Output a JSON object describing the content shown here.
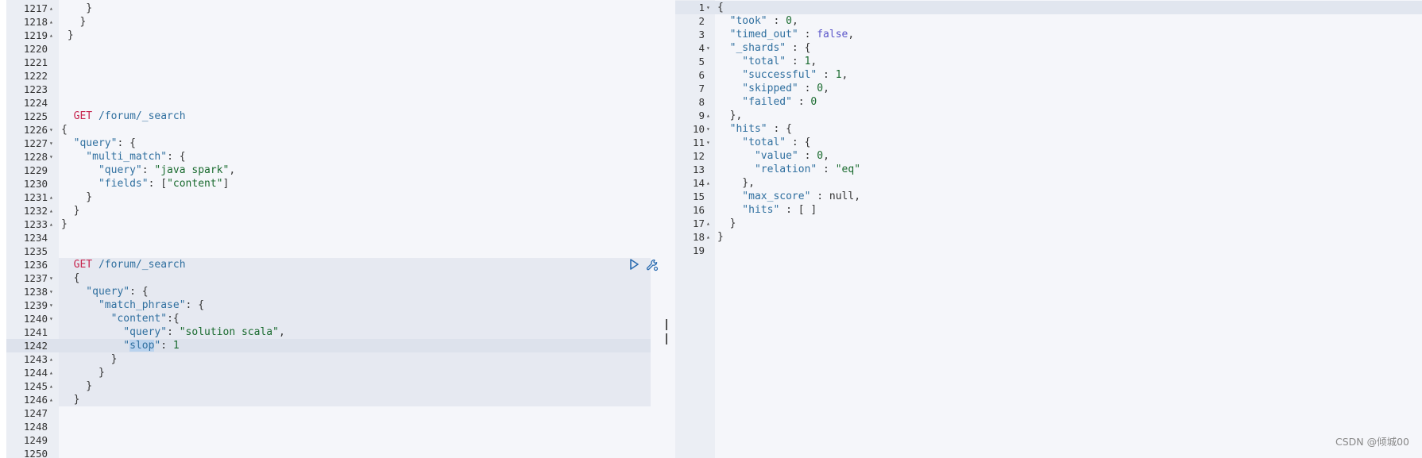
{
  "left": {
    "lines": [
      {
        "n": "1217",
        "fold": "▴",
        "code": [
          {
            "t": "    }",
            "c": "p"
          }
        ]
      },
      {
        "n": "1218",
        "fold": "▴",
        "code": [
          {
            "t": "   }",
            "c": "p"
          }
        ]
      },
      {
        "n": "1219",
        "fold": "▴",
        "code": [
          {
            "t": " }",
            "c": "p"
          }
        ]
      },
      {
        "n": "1220",
        "fold": "",
        "code": []
      },
      {
        "n": "1221",
        "fold": "",
        "code": []
      },
      {
        "n": "1222",
        "fold": "",
        "code": []
      },
      {
        "n": "1223",
        "fold": "",
        "code": []
      },
      {
        "n": "1224",
        "fold": "",
        "code": []
      },
      {
        "n": "1225",
        "fold": "",
        "code": [
          {
            "t": "  GET",
            "c": "m"
          },
          {
            "t": " /forum/_search",
            "c": "k"
          }
        ]
      },
      {
        "n": "1226",
        "fold": "▾",
        "code": [
          {
            "t": "{",
            "c": "p"
          }
        ]
      },
      {
        "n": "1227",
        "fold": "▾",
        "code": [
          {
            "t": "  \"query\"",
            "c": "k"
          },
          {
            "t": ": {",
            "c": "p"
          }
        ]
      },
      {
        "n": "1228",
        "fold": "▾",
        "code": [
          {
            "t": "    \"multi_match\"",
            "c": "k"
          },
          {
            "t": ": {",
            "c": "p"
          }
        ]
      },
      {
        "n": "1229",
        "fold": "",
        "code": [
          {
            "t": "      \"query\"",
            "c": "k"
          },
          {
            "t": ": ",
            "c": "p"
          },
          {
            "t": "\"java spark\"",
            "c": "s"
          },
          {
            "t": ",",
            "c": "p"
          }
        ]
      },
      {
        "n": "1230",
        "fold": "",
        "code": [
          {
            "t": "      \"fields\"",
            "c": "k"
          },
          {
            "t": ": [",
            "c": "p"
          },
          {
            "t": "\"content\"",
            "c": "s"
          },
          {
            "t": "]",
            "c": "p"
          }
        ]
      },
      {
        "n": "1231",
        "fold": "▴",
        "code": [
          {
            "t": "    }",
            "c": "p"
          }
        ]
      },
      {
        "n": "1232",
        "fold": "▴",
        "code": [
          {
            "t": "  }",
            "c": "p"
          }
        ]
      },
      {
        "n": "1233",
        "fold": "▴",
        "code": [
          {
            "t": "}",
            "c": "p"
          }
        ]
      },
      {
        "n": "1234",
        "fold": "",
        "code": []
      },
      {
        "n": "1235",
        "fold": "",
        "code": []
      },
      {
        "n": "1236",
        "fold": "",
        "code": [
          {
            "t": "  GET",
            "c": "m"
          },
          {
            "t": " /forum/_search",
            "c": "k"
          }
        ]
      },
      {
        "n": "1237",
        "fold": "▾",
        "code": [
          {
            "t": "  {",
            "c": "p"
          }
        ]
      },
      {
        "n": "1238",
        "fold": "▾",
        "code": [
          {
            "t": "    \"query\"",
            "c": "k"
          },
          {
            "t": ": {",
            "c": "p"
          }
        ]
      },
      {
        "n": "1239",
        "fold": "▾",
        "code": [
          {
            "t": "      \"match_phrase\"",
            "c": "k"
          },
          {
            "t": ": {",
            "c": "p"
          }
        ]
      },
      {
        "n": "1240",
        "fold": "▾",
        "code": [
          {
            "t": "        \"content\"",
            "c": "k"
          },
          {
            "t": ":{",
            "c": "p"
          }
        ]
      },
      {
        "n": "1241",
        "fold": "",
        "code": [
          {
            "t": "          \"query\"",
            "c": "k"
          },
          {
            "t": ": ",
            "c": "p"
          },
          {
            "t": "\"solution scala\"",
            "c": "s"
          },
          {
            "t": ",",
            "c": "p"
          }
        ]
      },
      {
        "n": "1242",
        "fold": "",
        "code": [
          {
            "t": "          \"",
            "c": "k"
          },
          {
            "t": "slop",
            "c": "k hl"
          },
          {
            "t": "\"",
            "c": "k"
          },
          {
            "t": ": ",
            "c": "p"
          },
          {
            "t": "1",
            "c": "n"
          }
        ]
      },
      {
        "n": "1243",
        "fold": "▴",
        "code": [
          {
            "t": "        }",
            "c": "p"
          }
        ]
      },
      {
        "n": "1244",
        "fold": "▴",
        "code": [
          {
            "t": "      }",
            "c": "p"
          }
        ]
      },
      {
        "n": "1245",
        "fold": "▴",
        "code": [
          {
            "t": "    }",
            "c": "p"
          }
        ]
      },
      {
        "n": "1246",
        "fold": "▴",
        "code": [
          {
            "t": "  }",
            "c": "p"
          }
        ]
      },
      {
        "n": "1247",
        "fold": "",
        "code": []
      },
      {
        "n": "1248",
        "fold": "",
        "code": []
      },
      {
        "n": "1249",
        "fold": "",
        "code": []
      },
      {
        "n": "1250",
        "fold": "",
        "code": []
      }
    ]
  },
  "right": {
    "lines": [
      {
        "n": "1",
        "fold": "▾",
        "code": [
          {
            "t": "{",
            "c": "p"
          }
        ]
      },
      {
        "n": "2",
        "fold": "",
        "code": [
          {
            "t": "  \"took\"",
            "c": "k"
          },
          {
            "t": " : ",
            "c": "p"
          },
          {
            "t": "0",
            "c": "n"
          },
          {
            "t": ",",
            "c": "p"
          }
        ]
      },
      {
        "n": "3",
        "fold": "",
        "code": [
          {
            "t": "  \"timed_out\"",
            "c": "k"
          },
          {
            "t": " : ",
            "c": "p"
          },
          {
            "t": "false",
            "c": "f"
          },
          {
            "t": ",",
            "c": "p"
          }
        ]
      },
      {
        "n": "4",
        "fold": "▾",
        "code": [
          {
            "t": "  \"_shards\"",
            "c": "k"
          },
          {
            "t": " : {",
            "c": "p"
          }
        ]
      },
      {
        "n": "5",
        "fold": "",
        "code": [
          {
            "t": "    \"total\"",
            "c": "k"
          },
          {
            "t": " : ",
            "c": "p"
          },
          {
            "t": "1",
            "c": "n"
          },
          {
            "t": ",",
            "c": "p"
          }
        ]
      },
      {
        "n": "6",
        "fold": "",
        "code": [
          {
            "t": "    \"successful\"",
            "c": "k"
          },
          {
            "t": " : ",
            "c": "p"
          },
          {
            "t": "1",
            "c": "n"
          },
          {
            "t": ",",
            "c": "p"
          }
        ]
      },
      {
        "n": "7",
        "fold": "",
        "code": [
          {
            "t": "    \"skipped\"",
            "c": "k"
          },
          {
            "t": " : ",
            "c": "p"
          },
          {
            "t": "0",
            "c": "n"
          },
          {
            "t": ",",
            "c": "p"
          }
        ]
      },
      {
        "n": "8",
        "fold": "",
        "code": [
          {
            "t": "    \"failed\"",
            "c": "k"
          },
          {
            "t": " : ",
            "c": "p"
          },
          {
            "t": "0",
            "c": "n"
          }
        ]
      },
      {
        "n": "9",
        "fold": "▴",
        "code": [
          {
            "t": "  },",
            "c": "p"
          }
        ]
      },
      {
        "n": "10",
        "fold": "▾",
        "code": [
          {
            "t": "  \"hits\"",
            "c": "k"
          },
          {
            "t": " : {",
            "c": "p"
          }
        ]
      },
      {
        "n": "11",
        "fold": "▾",
        "code": [
          {
            "t": "    \"total\"",
            "c": "k"
          },
          {
            "t": " : {",
            "c": "p"
          }
        ]
      },
      {
        "n": "12",
        "fold": "",
        "code": [
          {
            "t": "      \"value\"",
            "c": "k"
          },
          {
            "t": " : ",
            "c": "p"
          },
          {
            "t": "0",
            "c": "n"
          },
          {
            "t": ",",
            "c": "p"
          }
        ]
      },
      {
        "n": "13",
        "fold": "",
        "code": [
          {
            "t": "      \"relation\"",
            "c": "k"
          },
          {
            "t": " : ",
            "c": "p"
          },
          {
            "t": "\"eq\"",
            "c": "s"
          }
        ]
      },
      {
        "n": "14",
        "fold": "▴",
        "code": [
          {
            "t": "    },",
            "c": "p"
          }
        ]
      },
      {
        "n": "15",
        "fold": "",
        "code": [
          {
            "t": "    \"max_score\"",
            "c": "k"
          },
          {
            "t": " : ",
            "c": "p"
          },
          {
            "t": "null",
            "c": "p"
          },
          {
            "t": ",",
            "c": "p"
          }
        ]
      },
      {
        "n": "16",
        "fold": "",
        "code": [
          {
            "t": "    \"hits\"",
            "c": "k"
          },
          {
            "t": " : [ ]",
            "c": "p"
          }
        ]
      },
      {
        "n": "17",
        "fold": "▴",
        "code": [
          {
            "t": "  }",
            "c": "p"
          }
        ]
      },
      {
        "n": "18",
        "fold": "▴",
        "code": [
          {
            "t": "}",
            "c": "p"
          }
        ]
      },
      {
        "n": "19",
        "fold": "",
        "code": []
      }
    ]
  },
  "watermark": "CSDN @倾城00",
  "colors": {
    "key": "#2f6f9f",
    "string": "#1a6b2f",
    "method": "#c7254e",
    "literal": "#5a55c9"
  },
  "icons": {
    "run": "play-icon",
    "settings": "wrench-icon",
    "divider": "resize-handle-icon"
  }
}
